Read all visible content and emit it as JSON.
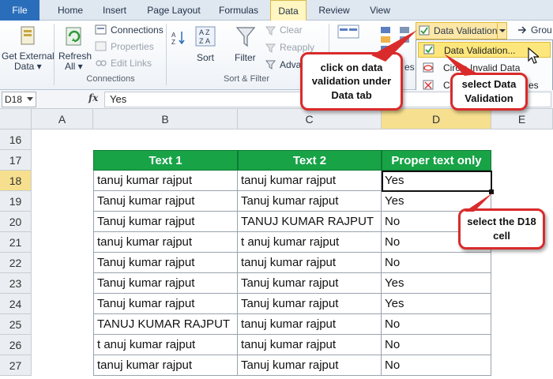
{
  "tabs": [
    {
      "id": "file",
      "label": "File"
    },
    {
      "id": "home",
      "label": "Home"
    },
    {
      "id": "insert",
      "label": "Insert"
    },
    {
      "id": "page_layout",
      "label": "Page Layout"
    },
    {
      "id": "formulas",
      "label": "Formulas"
    },
    {
      "id": "data",
      "label": "Data"
    },
    {
      "id": "review",
      "label": "Review"
    },
    {
      "id": "view",
      "label": "View"
    }
  ],
  "ribbon": {
    "get_external_data": "Get External",
    "get_external_data_2": "Data ▾",
    "refresh": "Refresh",
    "refresh_2": "All ▾",
    "connections": "Connections",
    "properties": "Properties",
    "edit_links": "Edit Links",
    "connections_group": "Connections",
    "sort": "Sort",
    "filter": "Filter",
    "clear": "Clear",
    "reapply": "Reapply",
    "advanced": "Adva",
    "sort_filter_group": "Sort & Filter",
    "data_validation": "Data Validation",
    "group": "Grou",
    "es": "es"
  },
  "dv_menu": {
    "item1": "Data Validation...",
    "item2": "Circle Invalid Data",
    "item3": "Cl",
    "item3_tail": "es"
  },
  "formula_bar": {
    "name_box": "D18",
    "fx": "fx",
    "value": "Yes"
  },
  "columns": [
    "A",
    "B",
    "C",
    "D",
    "E"
  ],
  "rows": [
    "16",
    "17",
    "18",
    "19",
    "20",
    "21",
    "22",
    "23",
    "24",
    "25",
    "26",
    "27"
  ],
  "table": {
    "headers": [
      "Text 1",
      "Text 2",
      "Proper text only"
    ],
    "data": [
      [
        "tanuj kumar rajput",
        "tanuj kumar rajput",
        "Yes"
      ],
      [
        "Tanuj kumar rajput",
        "Tanuj kumar rajput",
        "Yes"
      ],
      [
        "Tanuj kumar rajput",
        "TANUJ KUMAR RAJPUT",
        "No"
      ],
      [
        "tanuj kumar rajput",
        "t   anuj kumar rajput",
        "No"
      ],
      [
        "Tanuj kumar rajput",
        "tanuj kumar rajput",
        "No"
      ],
      [
        "Tanuj kumar rajput",
        "Tanuj kumar rajput",
        "Yes"
      ],
      [
        "Tanuj kumar rajput",
        "Tanuj kumar rajput",
        "Yes"
      ],
      [
        "TANUJ KUMAR RAJPUT",
        "tanuj kumar rajput",
        "No"
      ],
      [
        "t   anuj kumar rajput",
        "tanuj kumar rajput",
        "No"
      ],
      [
        "tanuj kumar rajput",
        "Tanuj kumar rajput",
        "No"
      ]
    ]
  },
  "callouts": {
    "c1": "click on data validation under Data tab",
    "c2": "select Data Validation",
    "c3": "select the D18 cell"
  },
  "colors": {
    "header_green": "#17a346",
    "callout_red": "#d92b2b",
    "selected_header": "#f6df8e",
    "menu_highlight": "#fde77c"
  }
}
